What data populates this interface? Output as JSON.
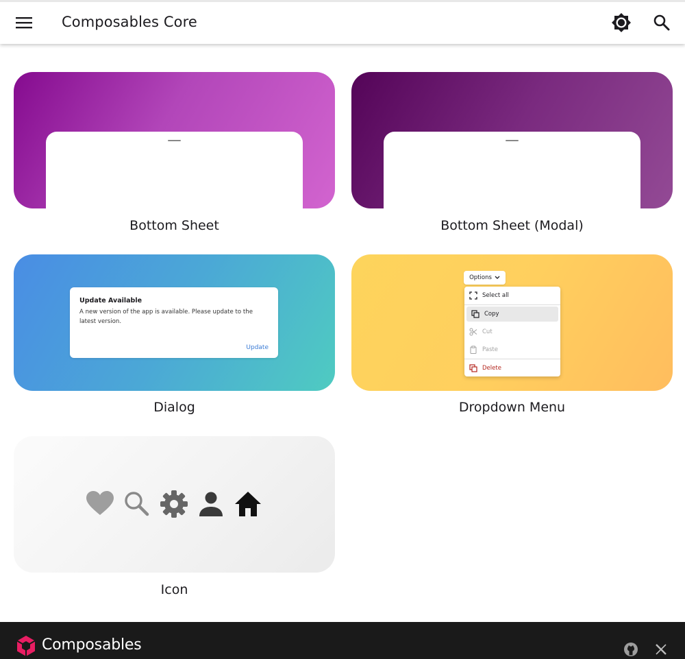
{
  "app": {
    "title": "Composables Core"
  },
  "cards": [
    {
      "label": "Bottom Sheet"
    },
    {
      "label": "Bottom Sheet (Modal)"
    },
    {
      "label": "Dialog"
    },
    {
      "label": "Dropdown Menu"
    },
    {
      "label": "Icon"
    }
  ],
  "dialog_preview": {
    "title": "Update Available",
    "text": "A new version of the app is available. Please update to the latest version.",
    "button": "Update"
  },
  "dropdown_preview": {
    "button": "Options",
    "items": [
      {
        "label": "Select all",
        "icon": "select-all-icon"
      },
      {
        "label": "Copy",
        "icon": "copy-icon"
      },
      {
        "label": "Cut",
        "icon": "cut-icon"
      },
      {
        "label": "Paste",
        "icon": "paste-icon"
      },
      {
        "label": "Delete",
        "icon": "delete-icon"
      }
    ]
  },
  "icon_preview": [
    "heart-icon",
    "search-icon",
    "gear-icon",
    "person-icon",
    "home-icon"
  ],
  "footer": {
    "brand": "Composables"
  },
  "colors": {
    "accent_pink": "#e91e63",
    "danger": "#b3261e",
    "link_blue": "#3a7bd5",
    "footer_bg": "#1a1a1a"
  }
}
